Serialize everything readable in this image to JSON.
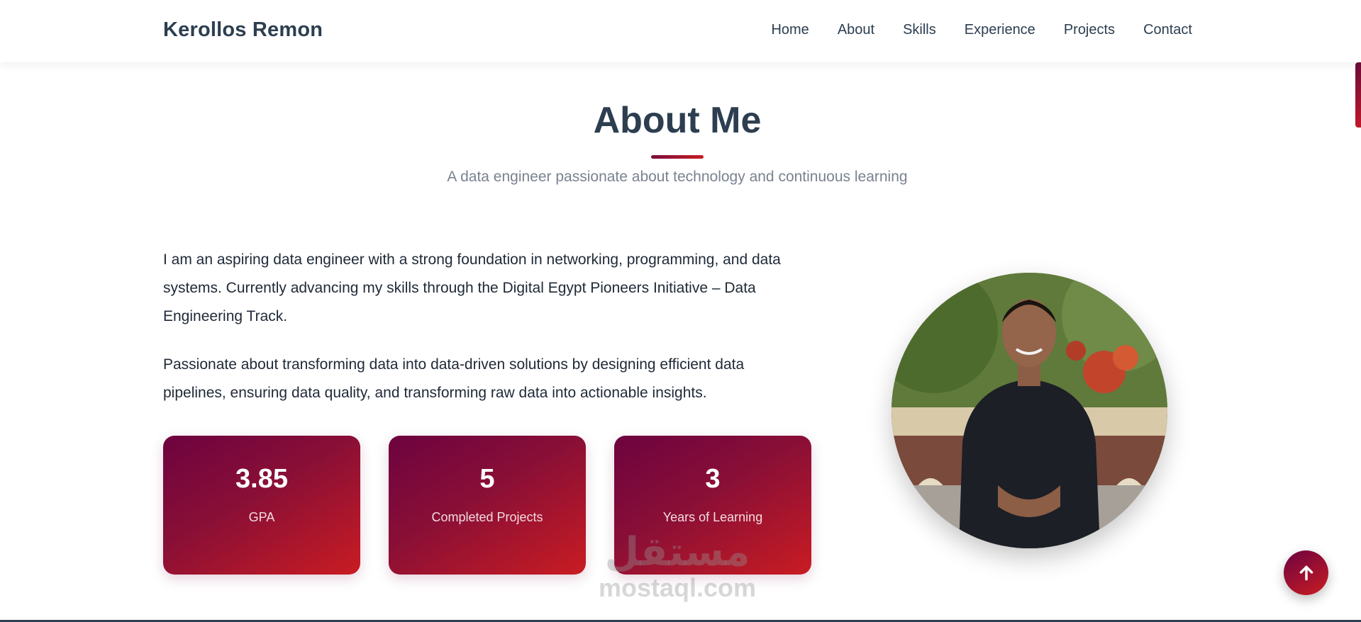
{
  "navbar": {
    "brand": "Kerollos Remon",
    "links": [
      "Home",
      "About",
      "Skills",
      "Experience",
      "Projects",
      "Contact"
    ]
  },
  "about": {
    "title": "About Me",
    "subtitle": "A data engineer passionate about technology and continuous learning",
    "paragraphs": [
      "I am an aspiring data engineer with a strong foundation in networking, programming, and data systems. Currently advancing my skills through the Digital Egypt Pioneers Initiative – Data Engineering Track.",
      "Passionate about transforming data into data-driven solutions by designing efficient data pipelines, ensuring data quality, and transforming raw data into actionable insights."
    ],
    "stats": [
      {
        "value": "3.85",
        "label": "GPA"
      },
      {
        "value": "5",
        "label": "Completed Projects"
      },
      {
        "value": "3",
        "label": "Years of Learning"
      }
    ]
  },
  "watermark": {
    "arabic": "مستقل",
    "latin": "mostaql.com"
  },
  "icons": {
    "back_to_top": "arrow-up-icon"
  },
  "colors": {
    "accent_start": "#6d0340",
    "accent_end": "#c91c22",
    "heading": "#2c3e50"
  }
}
